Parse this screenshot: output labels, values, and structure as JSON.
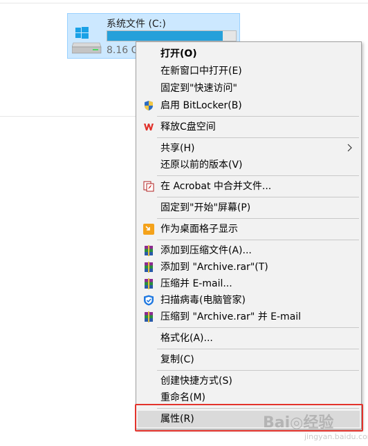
{
  "drive": {
    "name": "系统文件 (C:)",
    "free_text": "8.16 G",
    "usage_fraction": 0.9
  },
  "menu": {
    "items": [
      {
        "label": "打开(O)",
        "bold": true,
        "icon": ""
      },
      {
        "label": "在新窗口中打开(E)",
        "icon": ""
      },
      {
        "label": "固定到\"快速访问\"",
        "icon": ""
      },
      {
        "label": "启用 BitLocker(B)",
        "icon": "shield-icon"
      },
      {
        "label": "释放C盘空间",
        "icon": "wps-icon"
      },
      {
        "label": "共享(H)",
        "icon": "",
        "submenu": true
      },
      {
        "label": "还原以前的版本(V)",
        "icon": ""
      },
      {
        "label": "在 Acrobat 中合并文件...",
        "icon": "acrobat-icon"
      },
      {
        "label": "固定到\"开始\"屏幕(P)",
        "icon": ""
      },
      {
        "label": "作为桌面格子显示",
        "icon": "grid-icon"
      },
      {
        "label": "添加到压缩文件(A)...",
        "icon": "winrar-icon"
      },
      {
        "label": "添加到 \"Archive.rar\"(T)",
        "icon": "winrar-icon"
      },
      {
        "label": "压缩并 E-mail...",
        "icon": "winrar-icon"
      },
      {
        "label": "扫描病毒(电脑管家)",
        "icon": "tencent-shield-icon"
      },
      {
        "label": "压缩到 \"Archive.rar\" 并 E-mail",
        "icon": "winrar-icon"
      },
      {
        "label": "格式化(A)...",
        "icon": ""
      },
      {
        "label": "复制(C)",
        "icon": ""
      },
      {
        "label": "创建快捷方式(S)",
        "icon": ""
      },
      {
        "label": "重命名(M)",
        "icon": ""
      },
      {
        "label": "属性(R)",
        "icon": "",
        "highlighted": true
      }
    ]
  },
  "watermark": {
    "text": "Bai◎经验",
    "sub": "jingyan.baidu.com"
  },
  "colors": {
    "selection_bg": "#cce8ff",
    "bar_fill": "#26a0da",
    "menu_bg": "#f2f2f2",
    "highlight_border": "#e3322b"
  }
}
